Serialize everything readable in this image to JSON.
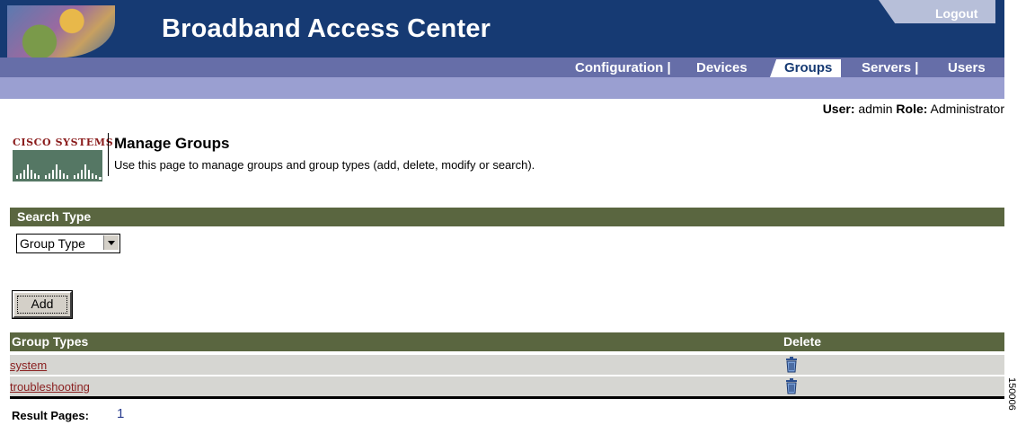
{
  "app": {
    "title": "Broadband Access Center",
    "logout_label": "Logout"
  },
  "nav": {
    "items": [
      {
        "label": "Configuration  |",
        "active": false
      },
      {
        "label": "Devices",
        "active": false
      },
      {
        "label": "Groups",
        "active": true
      },
      {
        "label": "Servers |",
        "active": false
      },
      {
        "label": "Users",
        "active": false
      }
    ]
  },
  "user": {
    "user_label": "User:",
    "user_value": "admin",
    "role_label": "Role:",
    "role_value": "Administrator"
  },
  "brand": {
    "company": "Cisco Systems"
  },
  "page": {
    "title": "Manage Groups",
    "description": "Use this page to manage groups and group types (add, delete, modify or search)."
  },
  "search": {
    "section_label": "Search Type",
    "selected": "Group Type"
  },
  "actions": {
    "add_label": "Add"
  },
  "table": {
    "col_name": "Group Types",
    "col_delete": "Delete",
    "rows": [
      {
        "name": "system"
      },
      {
        "name": "troubleshooting"
      }
    ]
  },
  "pagination": {
    "label": "Result Pages:",
    "pages": [
      "1"
    ]
  },
  "figure_id": "150006",
  "colors": {
    "header": "#163a73",
    "nav": "#666ea8",
    "subbar": "#9a9fd1",
    "section": "#5a6640",
    "row": "#d6d6d2",
    "link": "#8a2020"
  },
  "icons": {
    "delete": "trash-icon",
    "select_arrow": "chevron-down-icon"
  }
}
